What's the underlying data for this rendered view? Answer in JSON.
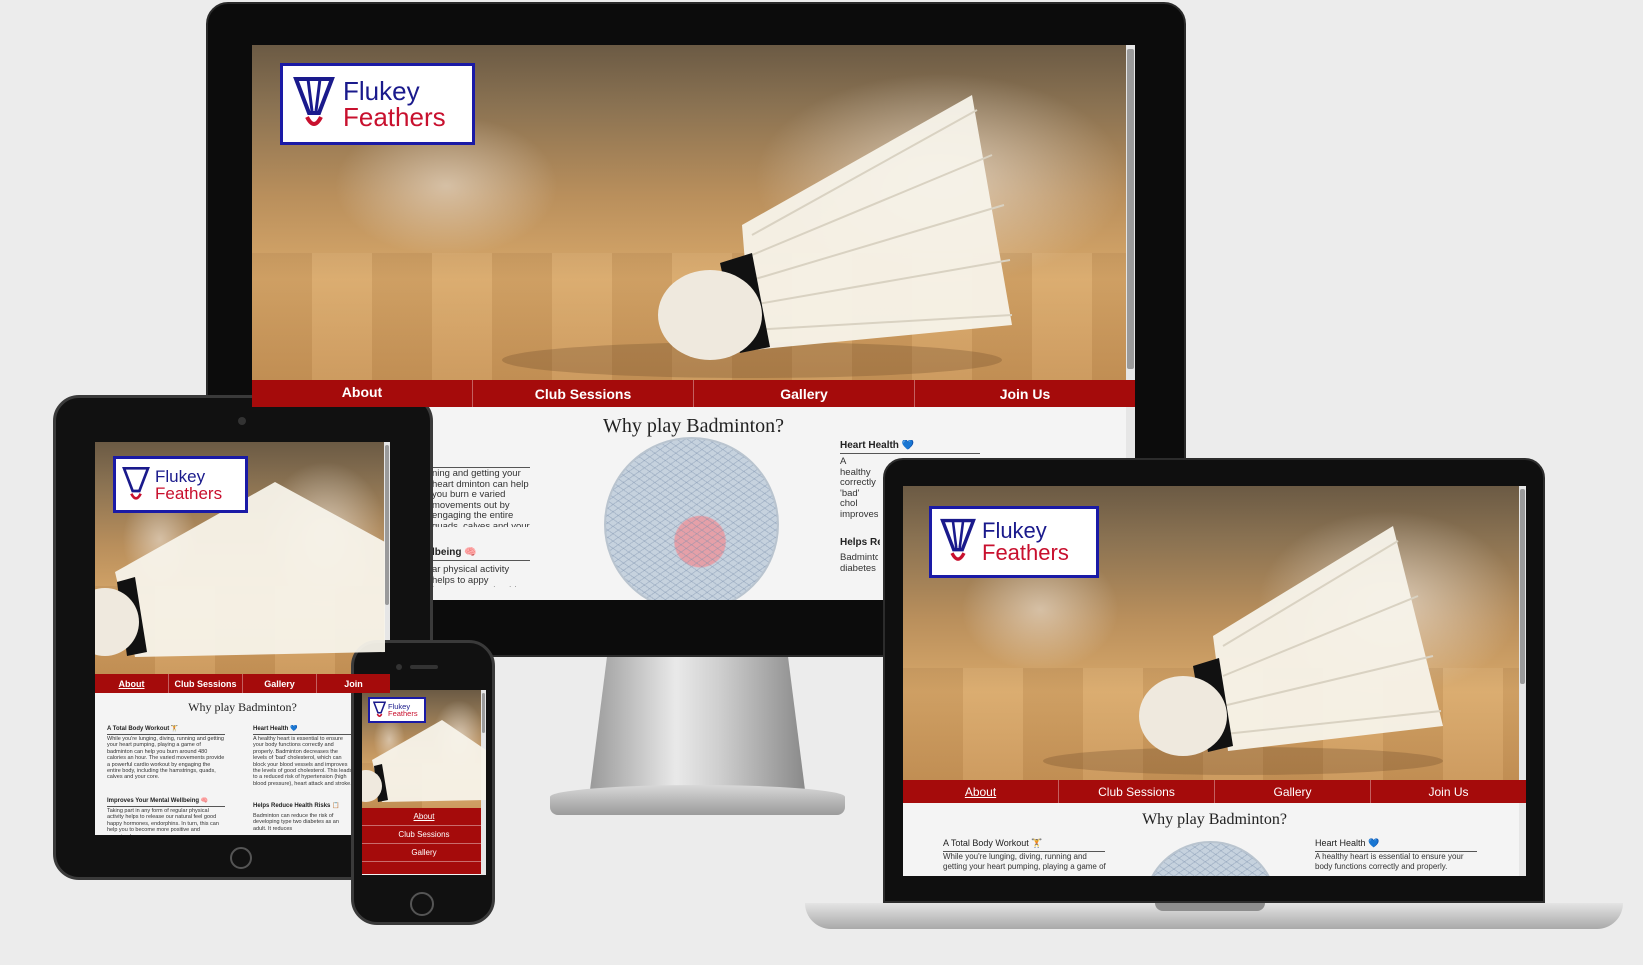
{
  "site": {
    "logo": {
      "line1": "Flukey",
      "line2": "Feathers"
    },
    "nav": [
      "About",
      "Club Sessions",
      "Gallery",
      "Join Us"
    ],
    "nav_short": [
      "About",
      "Club Sessions",
      "Gallery",
      "Join"
    ],
    "section_title": "Why play Badminton?",
    "features": {
      "workout": {
        "title": "A Total Body Workout 🏋",
        "body": "While you're lunging, diving, running and getting your heart pumping, playing a game of badminton can help you burn around 480 calories an hour. The varied movements provide a powerful cardio workout by engaging the entire body, including the hamstrings, quads, calves and your core."
      },
      "mental": {
        "title": "Improves Your Mental Wellbeing 🧠",
        "body": "Taking part in any form of regular physical activity helps to release our natural feel good happy hormones, endorphins. In turn, this can help you to become more positive and energised."
      },
      "heart": {
        "title": "Heart Health 💙",
        "body": "A healthy heart is essential to ensure your body functions correctly and properly. Badminton decreases the levels of 'bad' cholesterol, which can block your blood vessels and improves the levels of good cholesterol. This leads to a reduced risk of hypertension (high blood pressure), heart attack and stroke."
      },
      "diabetes": {
        "title": "Helps Reduce Health Risks 📋",
        "body": "Badminton can reduce the risk of developing type two diabetes as an adult. It reduces the build-up of sugar in the blood."
      }
    }
  },
  "monitor": {
    "partial": {
      "nav_about": "About",
      "workout_fragment": "ning and getting your heart dminton can help you burn e varied movements out by engaging the entire quads, calves and your",
      "mental_fragment_title": "lbeing 🧠",
      "mental_fragment_body": "ar physical activity helps to appy hormones, endorphins.",
      "heart_fragment_title": "Heart Health 💙",
      "heart_fragment_body": "A healthy correctly 'bad' chol improves reduced r attack an",
      "risk_fragment_title": "Helps Re",
      "risk_fragment_body": "Badminto diabetes"
    }
  },
  "tablet": {
    "heart_body": "A healthy heart is essential to ensure your body functions correctly and properly. Badminton decreases the levels of 'bad' cholesterol, which can block your blood vessels and improves the levels of good cholesterol. This leads to a reduced risk of hypertension (high blood pressure), heart attack and stroke.",
    "mental_body": "Taking part in any form of regular physical activity helps to release our natural feel good happy hormones, endorphins. In turn, this can help you to become more positive and energised.",
    "risk_body": "Badminton can reduce the risk of developing type two diabetes as an adult. It reduces"
  },
  "laptop": {
    "workout_body": "While you're lunging, diving, running and getting your heart pumping, playing a game of",
    "heart_body": "A healthy heart is essential to ensure your body functions correctly and properly."
  },
  "colors": {
    "nav": "#a50b0b",
    "logo_border": "#1a1aa6",
    "logo_blue": "#1a1a8c",
    "logo_red": "#c8102e"
  }
}
